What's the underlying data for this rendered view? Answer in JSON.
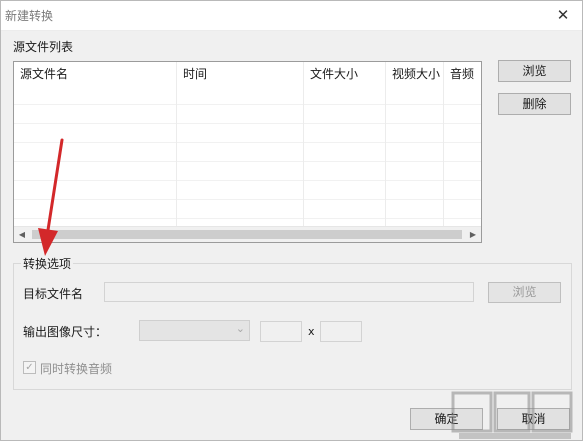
{
  "window": {
    "title": "新建转换",
    "close_glyph": "✕"
  },
  "source_list": {
    "label": "源文件列表",
    "columns": [
      "源文件名",
      "时间",
      "文件大小",
      "视频大小",
      "音频"
    ],
    "rows": []
  },
  "side_buttons": {
    "browse": "浏览",
    "delete": "删除"
  },
  "options": {
    "group_title": "转换选项",
    "target_label": "目标文件名",
    "target_value": "",
    "browse": "浏览",
    "size_label": "输出图像尺寸：",
    "size_selected": "",
    "width_value": "",
    "height_value": "",
    "x_sep": "x",
    "audio_checkbox_label": "同时转换音频",
    "audio_checked": true
  },
  "footer": {
    "ok": "确定",
    "cancel": "取消"
  },
  "overlay": {
    "annotation_color": "#d3282a"
  }
}
